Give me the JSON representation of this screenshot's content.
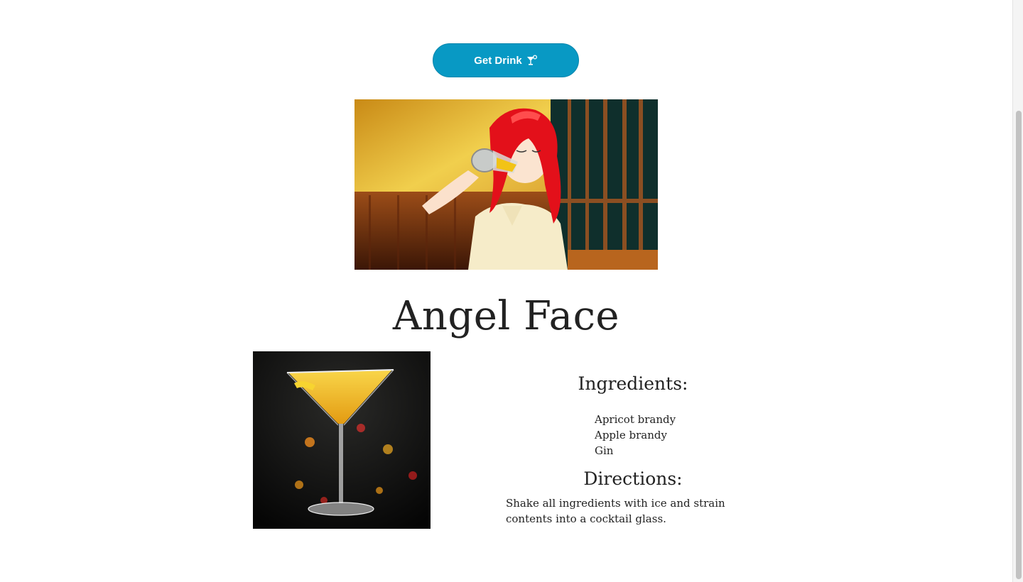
{
  "button": {
    "label": "Get Drink",
    "icon": "cocktail-glass-icon"
  },
  "banner": {
    "alt": "anime character drinking from a glass"
  },
  "drink": {
    "name": "Angel Face",
    "photo_alt": "Angel Face cocktail in martini glass"
  },
  "ingredients": {
    "heading": "Ingredients:",
    "items": [
      "Apricot brandy",
      "Apple brandy",
      "Gin"
    ]
  },
  "directions": {
    "heading": "Directions:",
    "text": "Shake all ingredients with ice and strain contents into a cocktail glass."
  },
  "colors": {
    "button_bg": "#0899c4",
    "button_text": "#ffffff",
    "text": "#222222"
  }
}
